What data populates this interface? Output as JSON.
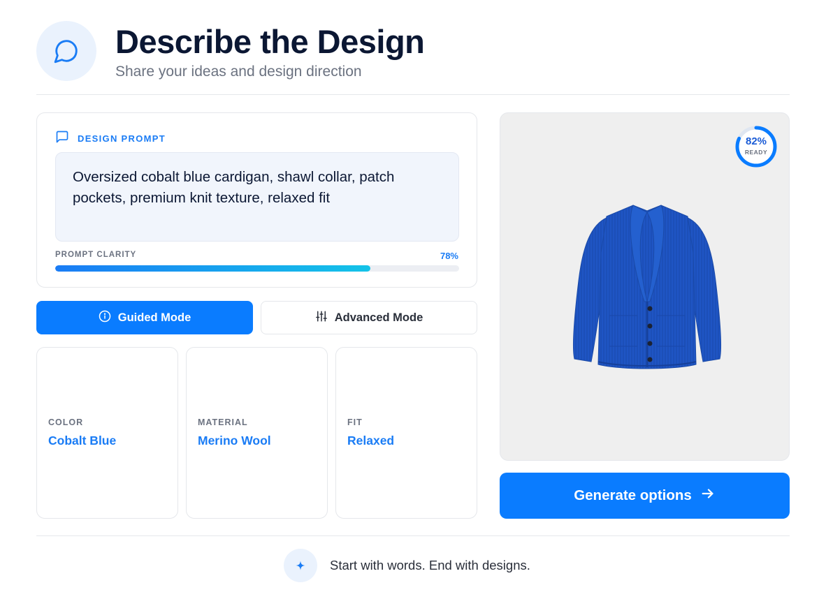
{
  "header": {
    "icon": "chat-bubble-icon",
    "title": "Describe the Design",
    "subtitle": "Share your ideas and design direction"
  },
  "prompt": {
    "icon": "message-square-icon",
    "label": "DESIGN PROMPT",
    "text": "Oversized cobalt blue cardigan, shawl collar, patch pockets, premium knit texture, relaxed fit",
    "clarity_label": "PROMPT CLARITY",
    "clarity_value": "78%",
    "clarity_fraction": 0.78
  },
  "modes": {
    "guided": {
      "label": "Guided Mode",
      "icon": "info-circle-icon",
      "active": true
    },
    "advanced": {
      "label": "Advanced Mode",
      "icon": "sliders-icon",
      "active": false
    }
  },
  "attributes": [
    {
      "label": "COLOR",
      "value": "Cobalt Blue"
    },
    {
      "label": "MATERIAL",
      "value": "Merino Wool"
    },
    {
      "label": "FIT",
      "value": "Relaxed"
    }
  ],
  "preview": {
    "readiness_value": "82%",
    "readiness_fraction": 0.82,
    "readiness_label": "READY",
    "image": "cobalt-blue-cardigan"
  },
  "generate": {
    "label": "Generate options",
    "icon": "arrow-right-icon"
  },
  "footer": {
    "icon": "sparkle-icon",
    "text": "Start with words. End with designs."
  },
  "colors": {
    "accent": "#0a7cff",
    "accent_text": "#1a7cf5",
    "garment": "#1f55c4"
  }
}
